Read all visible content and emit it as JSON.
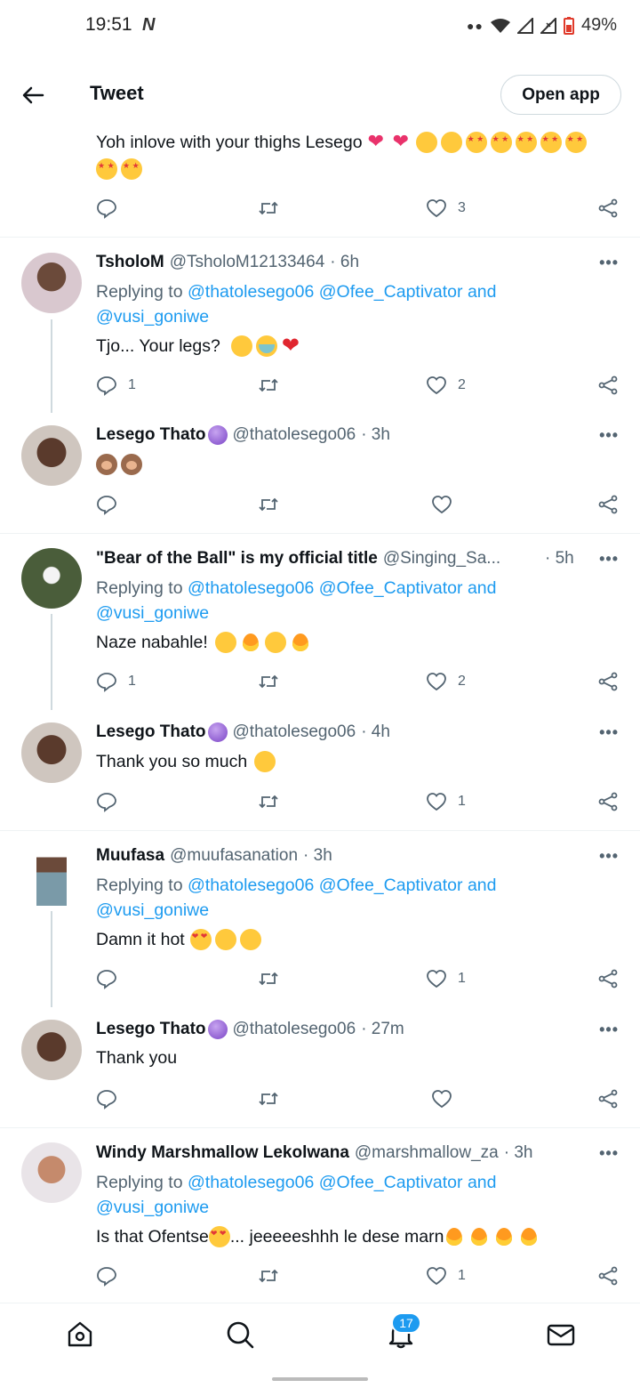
{
  "status_bar": {
    "time": "19:51",
    "notification_icon": "N",
    "battery": "49%",
    "icons": [
      "wifi-icon",
      "signal-icon",
      "signal-x-icon",
      "battery-icon"
    ]
  },
  "header": {
    "title": "Tweet",
    "open_app_label": "Open app"
  },
  "tweets": [
    {
      "text": "Yoh inlove with your thighs Lesego",
      "reply_count": "",
      "like_count": "3"
    },
    {
      "name": "TsholoM",
      "handle": "@TsholoM12133464",
      "time": "· 6h",
      "replying_prefix": "Replying to",
      "mentions": [
        "@thatolesego06",
        "@Ofee_Captivator",
        "and",
        "@vusi_goniwe"
      ],
      "text": "Tjo... Your legs?",
      "reply_count": "1",
      "like_count": "2"
    },
    {
      "name": "Lesego Thato",
      "handle": "@thatolesego06",
      "time": "· 3h",
      "text": "",
      "reply_count": "",
      "like_count": ""
    },
    {
      "name": "\"Bear of the Ball\" is my official title",
      "handle": "@Singing_Sa...",
      "time": "· 5h",
      "replying_prefix": "Replying to",
      "mentions": [
        "@thatolesego06",
        "@Ofee_Captivator",
        "and",
        "@vusi_goniwe"
      ],
      "text": "Naze nabahle!",
      "reply_count": "1",
      "like_count": "2"
    },
    {
      "name": "Lesego Thato",
      "handle": "@thatolesego06",
      "time": "· 4h",
      "text": "Thank you so much",
      "reply_count": "",
      "like_count": "1"
    },
    {
      "name": "Muufasa",
      "handle": "@muufasanation",
      "time": "· 3h",
      "replying_prefix": "Replying to",
      "mentions": [
        "@thatolesego06",
        "@Ofee_Captivator",
        "and",
        "@vusi_goniwe"
      ],
      "text": "Damn it hot",
      "reply_count": "",
      "like_count": "1"
    },
    {
      "name": "Lesego Thato",
      "handle": "@thatolesego06",
      "time": "· 27m",
      "text": "Thank you",
      "reply_count": "",
      "like_count": ""
    },
    {
      "name": "Windy Marshmallow Lekolwana",
      "handle": "@marshmallow_za",
      "time": "· 3h",
      "replying_prefix": "Replying to",
      "mentions": [
        "@thatolesego06",
        "@Ofee_Captivator",
        "and",
        "@vusi_goniwe"
      ],
      "text_before": "Is that Ofentse",
      "text_after": "... jeeeeeshhh le dese marn",
      "reply_count": "",
      "like_count": "1"
    }
  ],
  "more_label": "•••",
  "bottom_nav": {
    "items": [
      "home-icon",
      "search-icon",
      "notifications-icon",
      "messages-icon"
    ],
    "notification_badge": "17"
  },
  "colors": {
    "accent": "#1d9bf0",
    "muted": "#536471",
    "divider": "#eff3f4"
  }
}
